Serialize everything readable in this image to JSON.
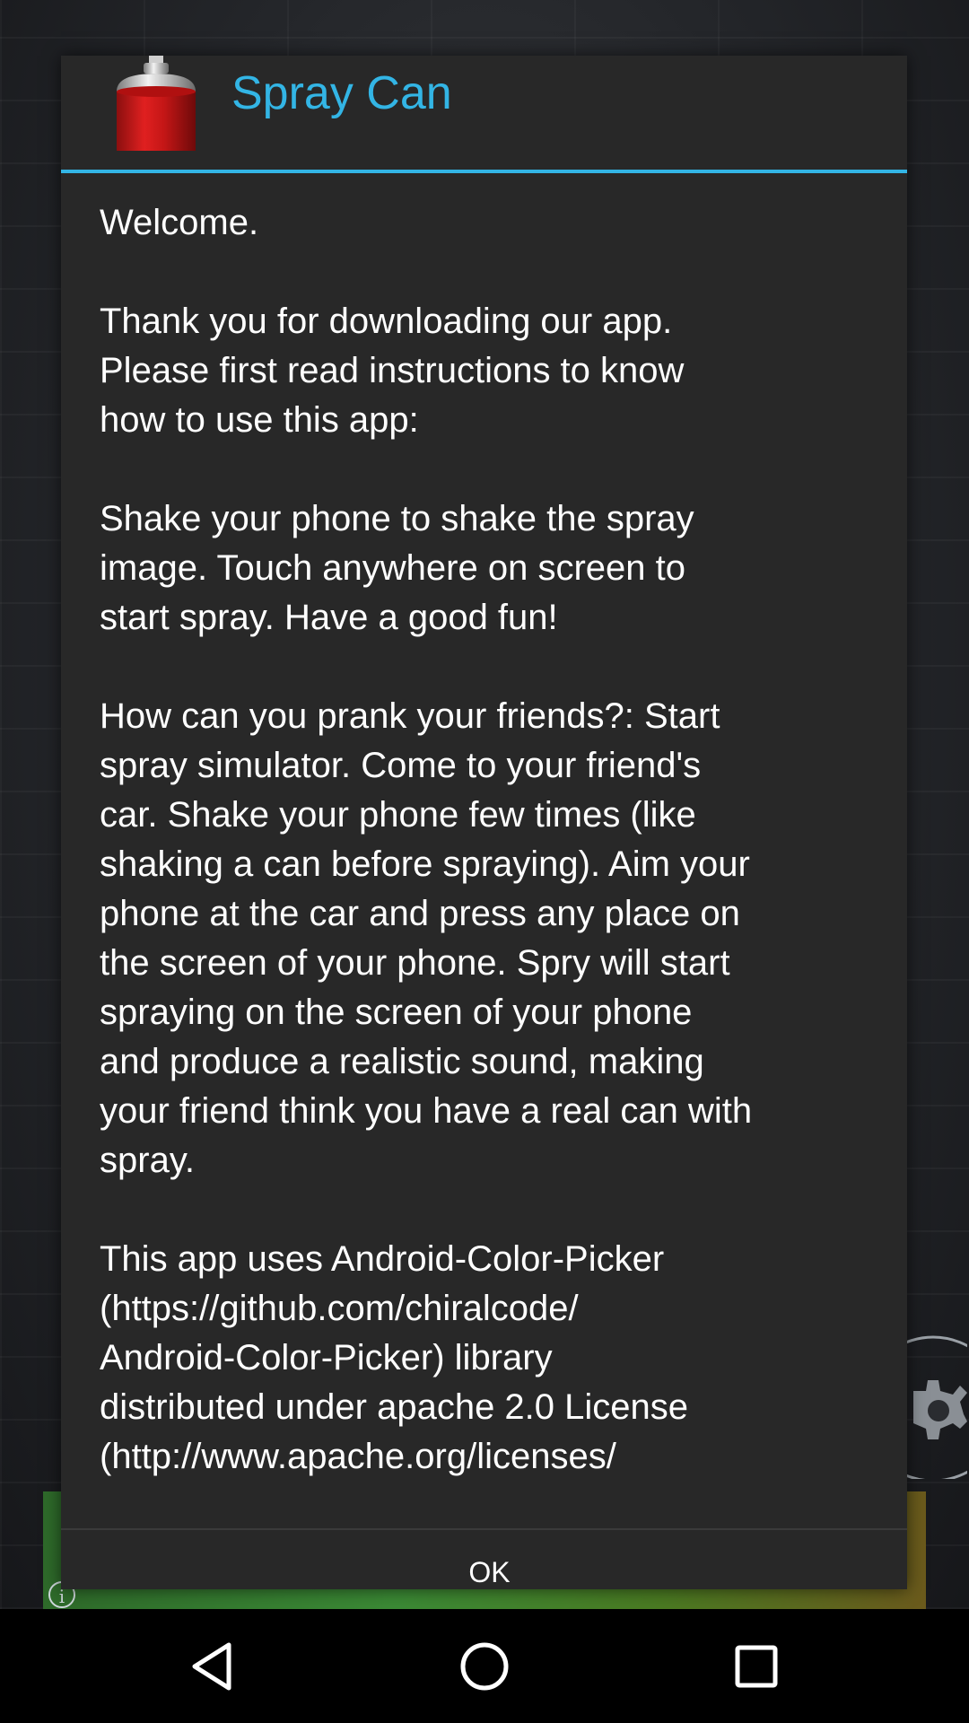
{
  "dialog": {
    "title": "Spray Can",
    "app_icon": "spray-can-icon",
    "message": "Welcome.\n\nThank you for downloading our app.\nPlease first read instructions to know\nhow to use this app:\n\nShake your phone to shake the spray\nimage. Touch anywhere on screen to\nstart spray. Have a good fun!\n\nHow can you prank your friends?: Start\nspray simulator. Come to your friend's\ncar. Shake your phone few times (like\nshaking a can before spraying). Aim your\nphone at the car and press any place on\nthe screen of your phone. Spry will start\nspraying on the screen of your phone\nand produce a realistic sound, making\nyour friend think you have a real can with\nspray.\n\nThis app uses Android-Color-Picker\n(https://github.com/chiralcode/\nAndroid-Color-Picker) library\ndistributed under apache 2.0 License\n(http://www.apache.org/licenses/",
    "ok_label": "OK"
  },
  "colors": {
    "accent": "#33b5e5",
    "dialog_bg": "#282828",
    "text": "#ffffff",
    "nav_bg": "#000000"
  },
  "background": {
    "icons": [
      "info-icon",
      "gear-icon"
    ]
  },
  "nav": {
    "icons": [
      "back-icon",
      "home-icon",
      "recents-icon"
    ]
  }
}
